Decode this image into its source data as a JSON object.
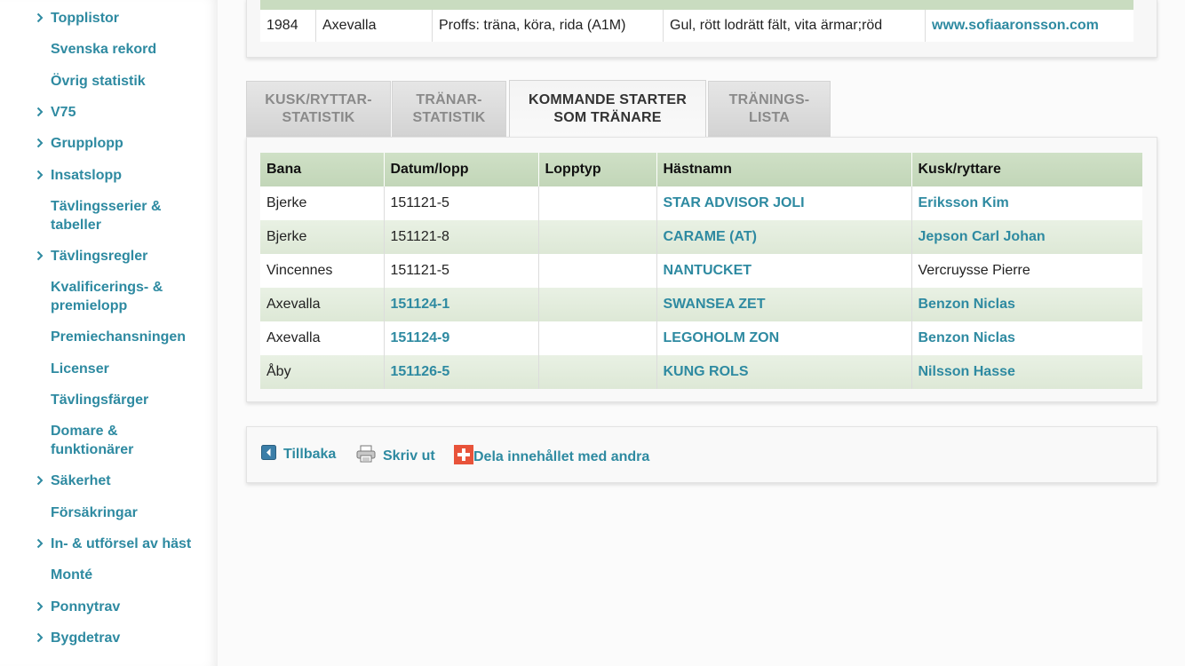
{
  "sidebar": {
    "items": [
      {
        "label": "Topplistor",
        "chevron": true
      },
      {
        "label": "Svenska rekord",
        "chevron": false
      },
      {
        "label": "Övrig statistik",
        "chevron": false
      },
      {
        "label": "V75",
        "chevron": true
      },
      {
        "label": "Grupplopp",
        "chevron": true
      },
      {
        "label": "Insatslopp",
        "chevron": true
      },
      {
        "label": "Tävlingsserier & tabeller",
        "chevron": false
      },
      {
        "label": "Tävlingsregler",
        "chevron": true
      },
      {
        "label": "Kvalificerings- & premielopp",
        "chevron": false
      },
      {
        "label": "Premiechansningen",
        "chevron": false
      },
      {
        "label": "Licenser",
        "chevron": false
      },
      {
        "label": "Tävlingsfärger",
        "chevron": false
      },
      {
        "label": "Domare & funktionärer",
        "chevron": false
      },
      {
        "label": "Säkerhet",
        "chevron": true
      },
      {
        "label": "Försäkringar",
        "chevron": false
      },
      {
        "label": "In- & utförsel av häst",
        "chevron": true
      },
      {
        "label": "Monté",
        "chevron": false
      },
      {
        "label": "Ponnytrav",
        "chevron": true
      },
      {
        "label": "Bygdetrav",
        "chevron": true
      }
    ]
  },
  "trainer_row": {
    "year": "1984",
    "track": "Axevalla",
    "license": "Proffs: träna, köra, rida (A1M)",
    "colors": "Gul, rött lodrätt fält, vita ärmar;röd",
    "website": "www.sofiaaronsson.com"
  },
  "tabs": {
    "driver_stats": "KUSK/RYTTAR-\nSTATISTIK",
    "trainer_stats": "TRÄNAR-\nSTATISTIK",
    "upcoming": "KOMMANDE STARTER\nSOM TRÄNARE",
    "training_list": "TRÄNINGS-\nLISTA"
  },
  "starts_table": {
    "headers": [
      "Bana",
      "Datum/lopp",
      "Lopptyp",
      "Hästnamn",
      "Kusk/ryttare"
    ],
    "rows": [
      {
        "track": "Bjerke",
        "race": "151121-5",
        "race_link": false,
        "type": "",
        "horse": "STAR ADVISOR JOLI",
        "driver": "Eriksson Kim",
        "driver_link": true
      },
      {
        "track": "Bjerke",
        "race": "151121-8",
        "race_link": false,
        "type": "",
        "horse": "CARAME (AT)",
        "driver": "Jepson Carl Johan",
        "driver_link": true
      },
      {
        "track": "Vincennes",
        "race": "151121-5",
        "race_link": false,
        "type": "",
        "horse": "NANTUCKET",
        "driver": "Vercruysse Pierre",
        "driver_link": false
      },
      {
        "track": "Axevalla",
        "race": "151124-1",
        "race_link": true,
        "type": "",
        "horse": "SWANSEA ZET",
        "driver": "Benzon Niclas",
        "driver_link": true
      },
      {
        "track": "Axevalla",
        "race": "151124-9",
        "race_link": true,
        "type": "",
        "horse": "LEGOHOLM ZON",
        "driver": "Benzon Niclas",
        "driver_link": true
      },
      {
        "track": "Åby",
        "race": "151126-5",
        "race_link": true,
        "type": "",
        "horse": "KUNG ROLS",
        "driver": "Nilsson Hasse",
        "driver_link": true
      }
    ]
  },
  "actions": {
    "back": "Tillbaka",
    "print": "Skriv ut",
    "share": "Dela innehållet med andra"
  },
  "colors": {
    "link": "#2e8aa1",
    "header_green": "#c9dcc0",
    "share_icon": "#e8533a"
  }
}
